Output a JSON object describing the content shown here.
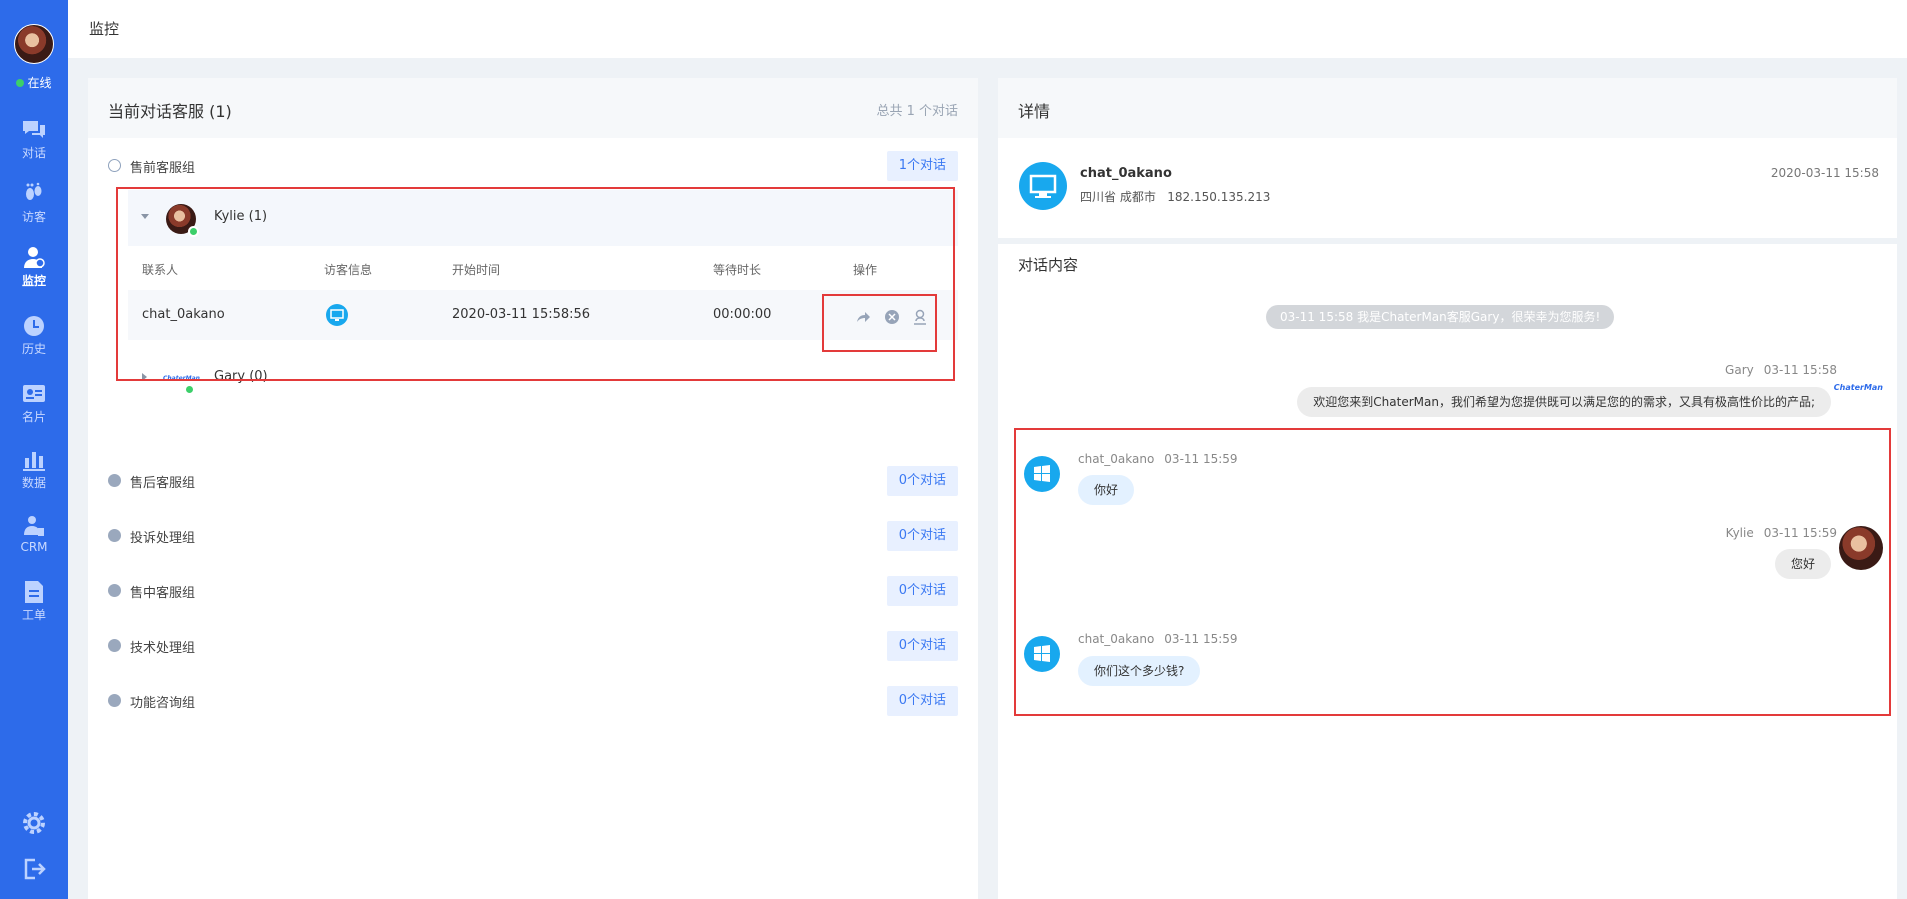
{
  "sidebar": {
    "status": "在线",
    "items": [
      {
        "label": "对话",
        "icon": "chat-icon"
      },
      {
        "label": "访客",
        "icon": "footprint-icon"
      },
      {
        "label": "监控",
        "icon": "monitor-user-icon"
      },
      {
        "label": "历史",
        "icon": "clock-icon"
      },
      {
        "label": "名片",
        "icon": "id-card-icon"
      },
      {
        "label": "数据",
        "icon": "bar-chart-icon"
      },
      {
        "label": "CRM",
        "icon": "crm-icon"
      },
      {
        "label": "工单",
        "icon": "document-icon"
      }
    ],
    "active": "监控",
    "bottom_icons": [
      "gear-icon",
      "logout-icon"
    ]
  },
  "topbar": {
    "title": "监控"
  },
  "left_panel": {
    "title": "当前对话客服 (1)",
    "summary": "总共 1 个对话",
    "groups": [
      {
        "name": "售前客服组",
        "count": "1个对话",
        "expanded": true
      },
      {
        "name": "售后客服组",
        "count": "0个对话"
      },
      {
        "name": "投诉处理组",
        "count": "0个对话"
      },
      {
        "name": "售中客服组",
        "count": "0个对话"
      },
      {
        "name": "技术处理组",
        "count": "0个对话"
      },
      {
        "name": "功能咨询组",
        "count": "0个对话"
      }
    ],
    "agents": [
      {
        "name": "Kylie (1)"
      },
      {
        "name": "Gary (0)",
        "logo_text": "ChaterMan"
      }
    ],
    "table": {
      "headers": [
        "联系人",
        "访客信息",
        "开始时间",
        "等待时长",
        "操作"
      ],
      "rows": [
        {
          "contact": "chat_0akano",
          "start": "2020-03-11 15:58:56",
          "wait": "00:00:00"
        }
      ]
    },
    "ops_icons": [
      "transfer-icon",
      "close-circle-icon",
      "monitor-join-icon"
    ]
  },
  "right_panel": {
    "title": "详情",
    "visitor": {
      "name": "chat_0akano",
      "location": "四川省 成都市",
      "ip": "182.150.135.213",
      "time": "2020-03-11 15:58"
    },
    "conversation_title": "对话内容",
    "system_message": "03-11 15:58 我是ChaterMan客服Gary，很荣幸为您服务!",
    "messages": [
      {
        "sender": "Gary",
        "time": "03-11 15:58",
        "text": "欢迎您来到ChaterMan，我们希望为您提供既可以满足您的的需求，又具有极高性价比的产品;",
        "side": "right",
        "logo_text": "ChaterMan"
      },
      {
        "sender": "chat_0akano",
        "time": "03-11 15:59",
        "text": "你好",
        "side": "left"
      },
      {
        "sender": "Kylie",
        "time": "03-11 15:59",
        "text": "您好",
        "side": "right"
      },
      {
        "sender": "chat_0akano",
        "time": "03-11 15:59",
        "text": "你们这个多少钱?",
        "side": "left"
      }
    ]
  },
  "colors": {
    "sidebar": "#2d6bea",
    "accent": "#3a78f2",
    "online": "#3ccf6a",
    "visitor_icon": "#18a8ee",
    "highlight": "#e33a3a"
  }
}
